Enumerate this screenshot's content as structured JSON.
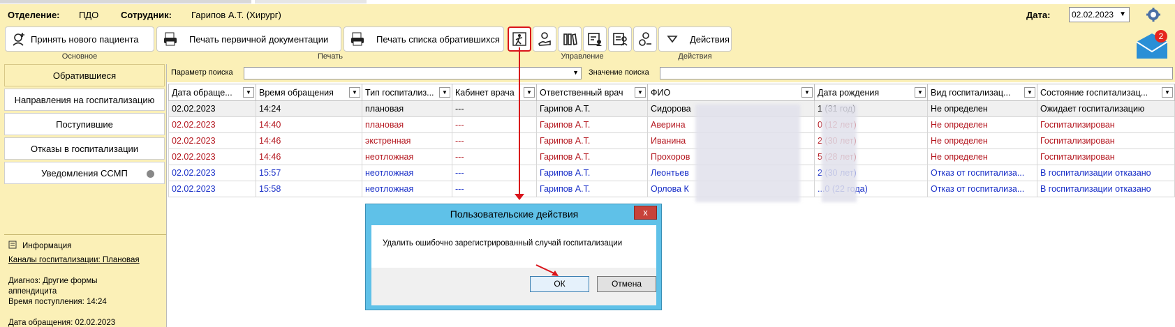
{
  "header": {
    "department_label": "Отделение:",
    "department_value": "ПДО",
    "employee_label": "Сотрудник:",
    "employee_value": "Гарипов А.Т. (Хирург)",
    "date_label": "Дата:",
    "date_value": "02.02.2023"
  },
  "toolbar": {
    "new_patient": "Принять нового пациента",
    "print_primary": "Печать первичной документации",
    "print_list": "Печать списка обратившихся",
    "actions": "Действия",
    "groups": [
      "Основное",
      "Печать",
      "Управление",
      "Действия"
    ]
  },
  "mail_badge": "2",
  "sidebar": {
    "items": [
      "Обратившиеся",
      "Направления на госпитализацию",
      "Поступившие",
      "Отказы в госпитализации",
      "Уведомления ССМП"
    ],
    "info_title": "Информация",
    "info_link": "Каналы госпитализации: Плановая",
    "info_lines": [
      "Диагноз: Другие формы",
      "аппендицита",
      "Время поступления: 14:24"
    ],
    "info_date": "Дата обращения: 02.02.2023"
  },
  "search": {
    "param_label": "Параметр поиска",
    "value_label": "Значение поиска"
  },
  "grid": {
    "columns": [
      "Дата обраще...",
      "Время обращения",
      "Тип госпитализ...",
      "Кабинет врача",
      "Ответственный врач",
      "ФИО",
      "Дата рождения",
      "Вид госпитализац...",
      "Состояние госпитализац..."
    ],
    "rows": [
      [
        "02.02.2023",
        "14:24",
        "плановая",
        "---",
        "Гарипов А.Т.",
        "Сидорова",
        "1 (31 год)",
        "Не определен",
        "Ожидает госпитализацию"
      ],
      [
        "02.02.2023",
        "14:40",
        "плановая",
        "---",
        "Гарипов А.Т.",
        "Аверина",
        "0 (12 лет)",
        "Не определен",
        "Госпитализирован"
      ],
      [
        "02.02.2023",
        "14:46",
        "экстренная",
        "---",
        "Гарипов А.Т.",
        "Иванина",
        "2 (30 лет)",
        "Не определен",
        "Госпитализирован"
      ],
      [
        "02.02.2023",
        "14:46",
        "неотложная",
        "---",
        "Гарипов А.Т.",
        "Прохоров",
        "5 (28 лет)",
        "Не определен",
        "Госпитализирован"
      ],
      [
        "02.02.2023",
        "15:57",
        "неотложная",
        "---",
        "Гарипов А.Т.",
        "Леонтьев",
        "2 (30 лет)",
        "Отказ от госпитализа...",
        "В госпитализации отказано"
      ],
      [
        "02.02.2023",
        "15:58",
        "неотложная",
        "---",
        "Гарипов А.Т.",
        "Орлова К",
        "...0 (22 года)",
        "Отказ от госпитализа...",
        "В госпитализации отказано"
      ]
    ]
  },
  "dialog": {
    "title": "Пользовательские действия",
    "close": "x",
    "message": "Удалить ошибочно зарегистрированный случай госпитализации",
    "ok": "ОК",
    "cancel": "Отмена"
  }
}
